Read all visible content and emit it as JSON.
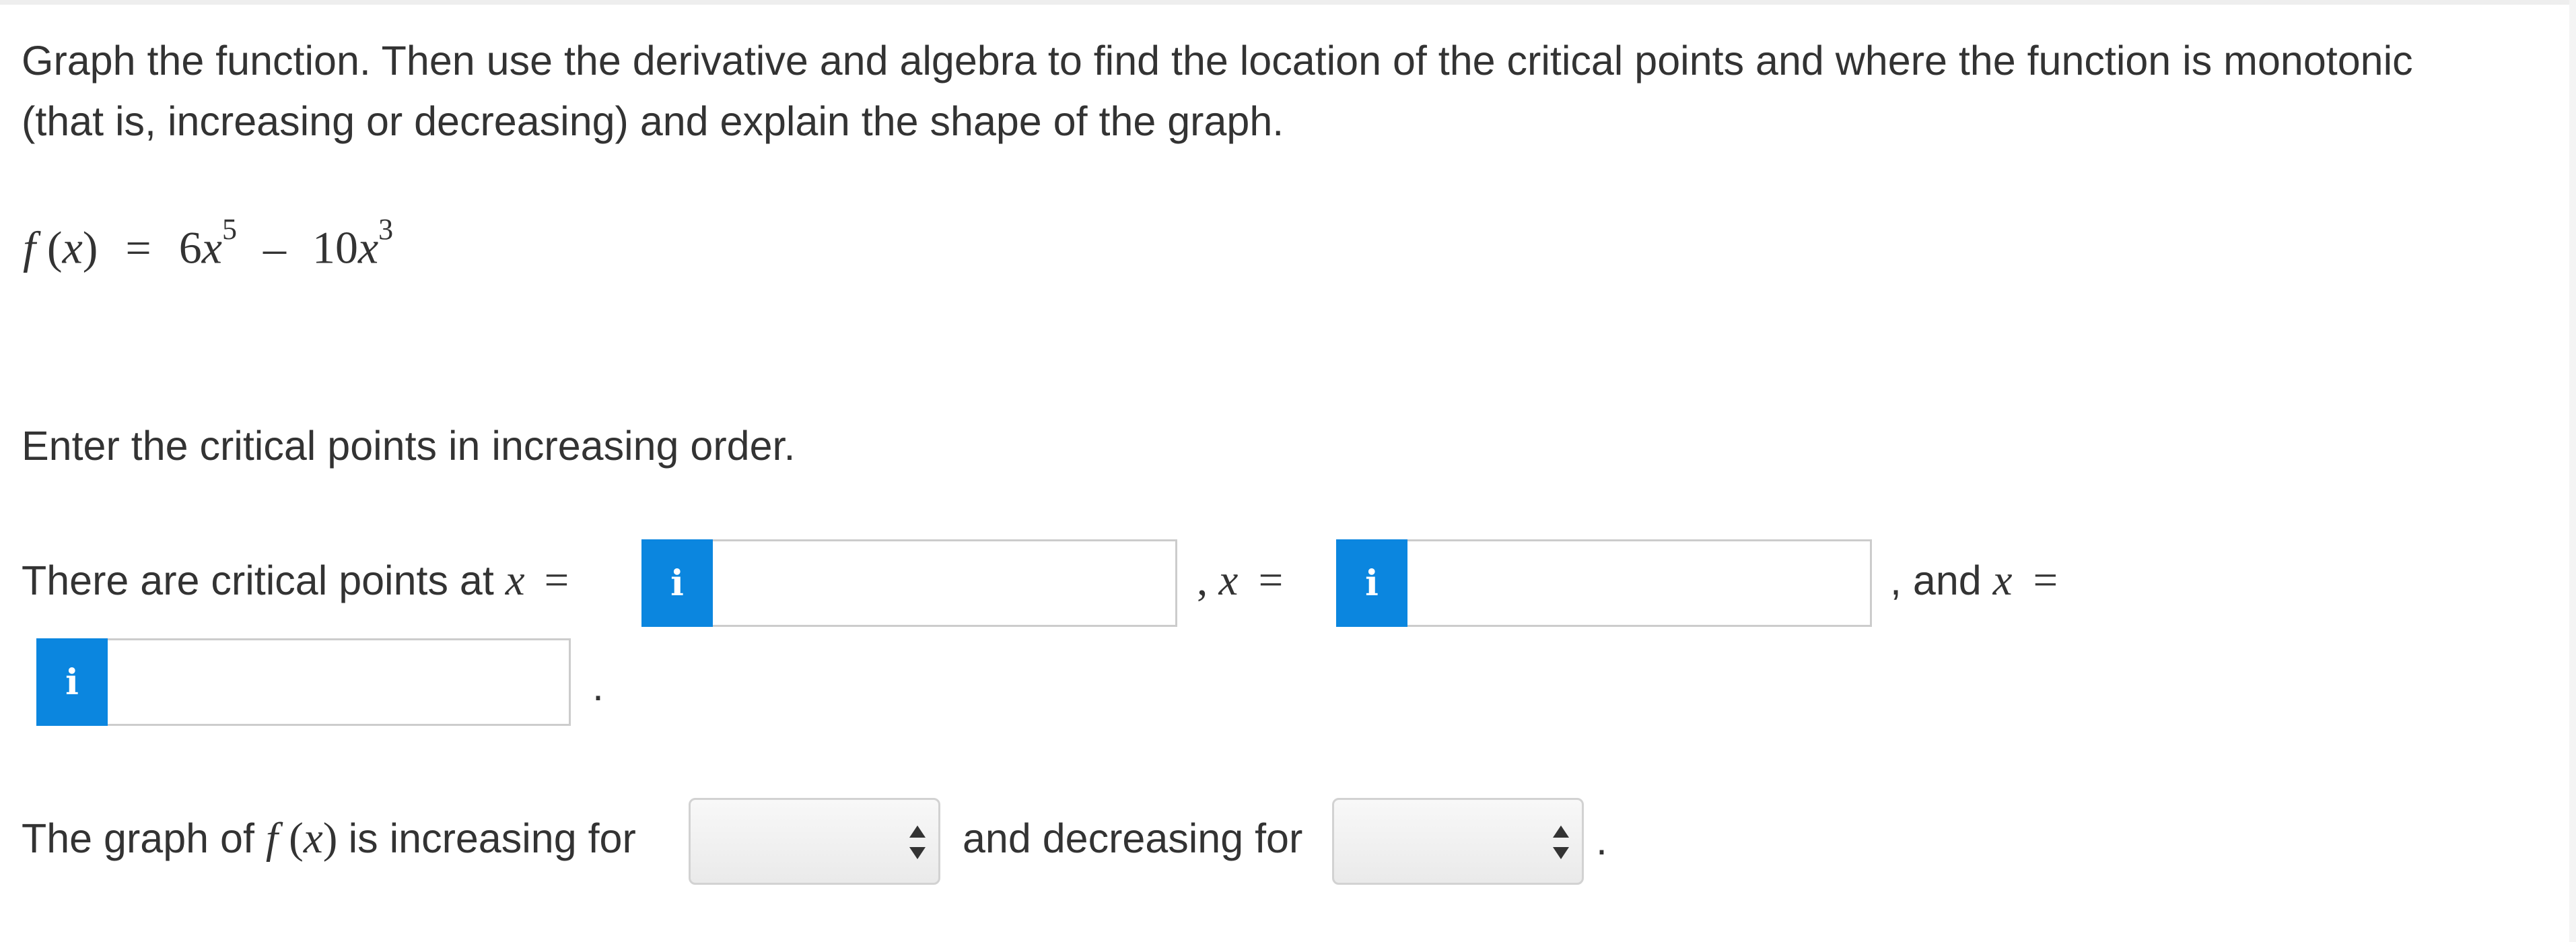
{
  "question": {
    "line1": "Graph the function. Then use the derivative and algebra to find the location of the critical points and where the function is monotonic",
    "line2": "(that is, increasing or decreasing) and explain the shape of the graph."
  },
  "function": {
    "f": "f",
    "x": "x",
    "coef1": "6",
    "exp1": "5",
    "coef2": "10",
    "exp2": "3"
  },
  "instruction": "Enter the critical points in increasing order.",
  "critical_points": {
    "prefix": "There are critical points at",
    "var": "x",
    "eq": "=",
    "sep": ",",
    "and_text": ", and",
    "period": ".",
    "info_icon": "info-icon",
    "inputs": [
      {
        "value": ""
      },
      {
        "value": ""
      },
      {
        "value": ""
      }
    ]
  },
  "monotonic": {
    "prefix": "The graph of",
    "func": "f",
    "var": "x",
    "increasing_label": "is increasing for",
    "decreasing_label": "and decreasing for",
    "period": ".",
    "increasing_selected": "",
    "decreasing_selected": ""
  },
  "colors": {
    "info_button": "#0b86df",
    "text": "#333333",
    "border": "#cccccc"
  }
}
